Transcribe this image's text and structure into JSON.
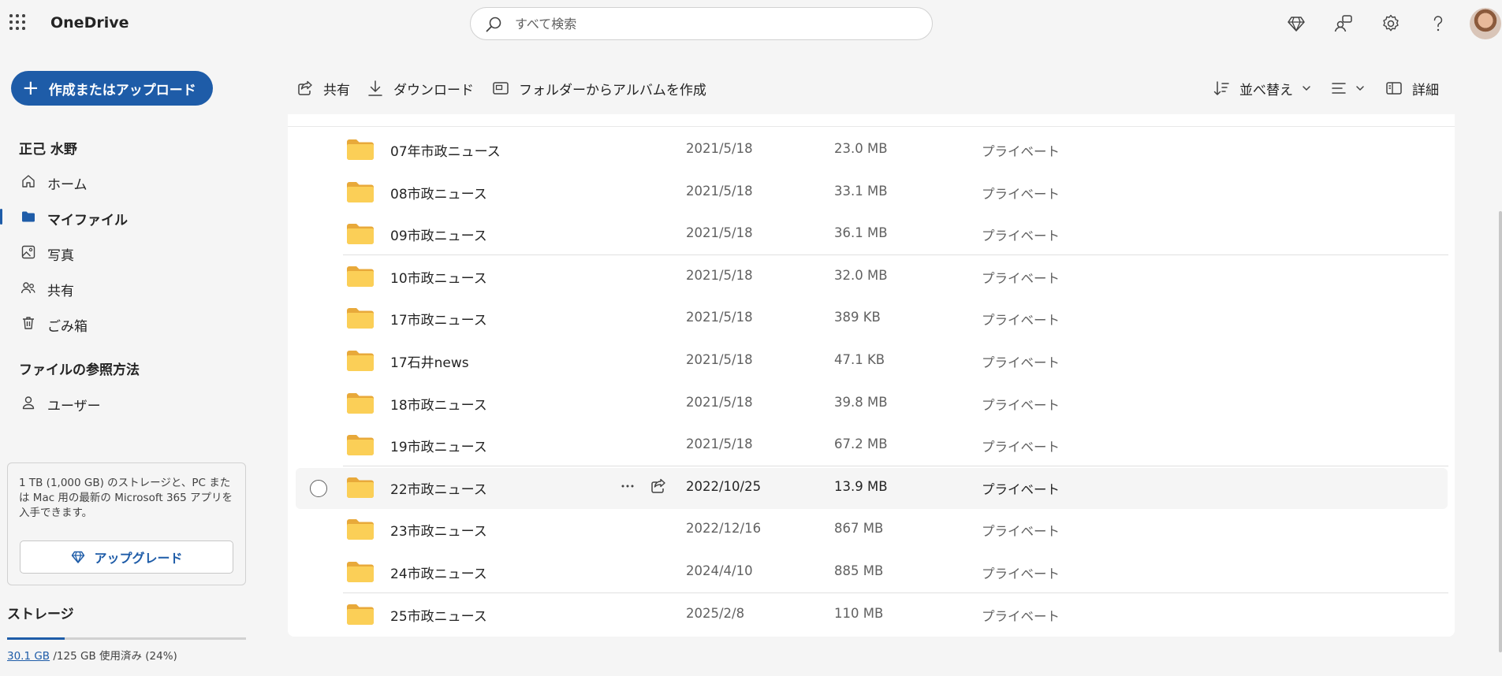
{
  "app": {
    "name": "OneDrive"
  },
  "search": {
    "placeholder": "すべて検索"
  },
  "sidebar": {
    "create_label": "作成またはアップロード",
    "user_name": "正己 水野",
    "items": [
      {
        "label": "ホーム",
        "icon": "home-icon"
      },
      {
        "label": "マイファイル",
        "icon": "folder-icon",
        "active": true
      },
      {
        "label": "写真",
        "icon": "photo-icon"
      },
      {
        "label": "共有",
        "icon": "people-icon"
      },
      {
        "label": "ごみ箱",
        "icon": "trash-icon"
      }
    ],
    "browse_heading": "ファイルの参照方法",
    "browse_items": [
      {
        "label": "ユーザー",
        "icon": "person-icon"
      }
    ],
    "promo": {
      "text": "1 TB (1,000 GB) のストレージと、PC または Mac 用の最新の Microsoft 365 アプリを入手できます。",
      "upgrade_label": "アップグレード"
    },
    "storage": {
      "heading": "ストレージ",
      "used": "30.1 GB",
      "rest": " /125 GB 使用済み (24%)",
      "percent": 24
    }
  },
  "commands": {
    "share": "共有",
    "download": "ダウンロード",
    "album": "フォルダーからアルバムを作成",
    "sort": "並べ替え",
    "details": "詳細"
  },
  "files": [
    {
      "name": "07年市政ニュース",
      "date": "2021/5/18",
      "size": "23.0 MB",
      "access": "プライベート"
    },
    {
      "name": "08市政ニュース",
      "date": "2021/5/18",
      "size": "33.1 MB",
      "access": "プライベート"
    },
    {
      "name": "09市政ニュース",
      "date": "2021/5/18",
      "size": "36.1 MB",
      "access": "プライベート"
    },
    {
      "name": "10市政ニュース",
      "date": "2021/5/18",
      "size": "32.0 MB",
      "access": "プライベート"
    },
    {
      "name": "17市政ニュース",
      "date": "2021/5/18",
      "size": "389 KB",
      "access": "プライベート"
    },
    {
      "name": "17石井news",
      "date": "2021/5/18",
      "size": "47.1 KB",
      "access": "プライベート"
    },
    {
      "name": "18市政ニュース",
      "date": "2021/5/18",
      "size": "39.8 MB",
      "access": "プライベート"
    },
    {
      "name": "19市政ニュース",
      "date": "2021/5/18",
      "size": "67.2 MB",
      "access": "プライベート"
    },
    {
      "name": "22市政ニュース",
      "date": "2022/10/25",
      "size": "13.9 MB",
      "access": "プライベート",
      "hover": true
    },
    {
      "name": "23市政ニュース",
      "date": "2022/12/16",
      "size": "867 MB",
      "access": "プライベート"
    },
    {
      "name": "24市政ニュース",
      "date": "2024/4/10",
      "size": "885 MB",
      "access": "プライベート"
    },
    {
      "name": "25市政ニュース",
      "date": "2025/2/8",
      "size": "110 MB",
      "access": "プライベート"
    }
  ],
  "colors": {
    "accent": "#1e5ca8",
    "folder": "#f9c94e"
  }
}
